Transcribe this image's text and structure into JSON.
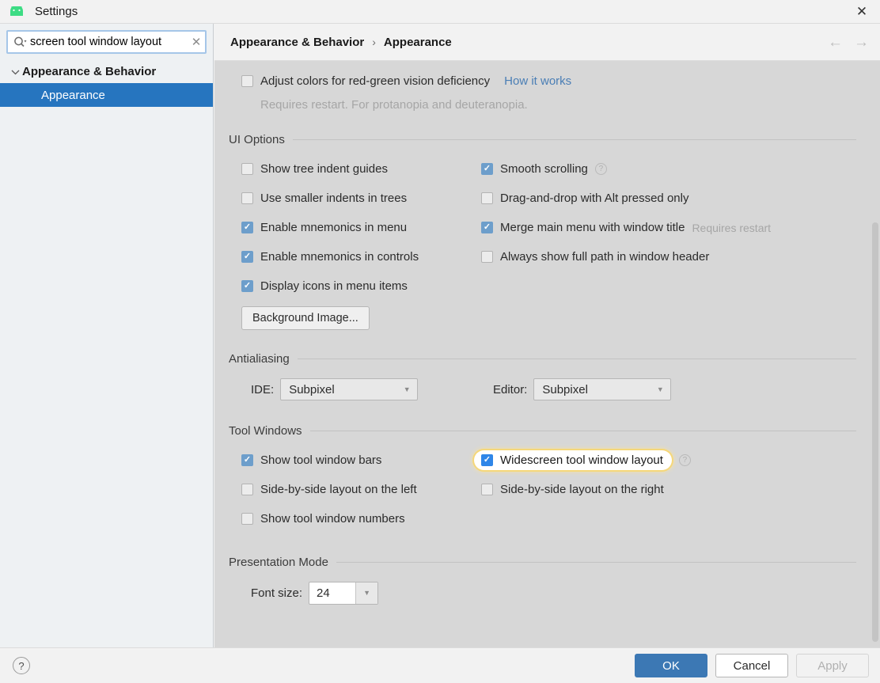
{
  "window": {
    "title": "Settings",
    "logo_icon": "android-studio-logo-icon",
    "close_icon": "close-icon"
  },
  "sidebar": {
    "search": {
      "value": "screen tool window layout",
      "placeholder": "Search settings",
      "search_icon": "search-icon",
      "clear_icon": "clear-icon"
    },
    "tree": [
      {
        "label": "Appearance & Behavior",
        "level": "root",
        "expanded": true,
        "selected": false,
        "chevron_icon": "chevron-down-icon"
      },
      {
        "label": "Appearance",
        "level": "child",
        "expanded": false,
        "selected": true
      }
    ]
  },
  "content": {
    "breadcrumb": {
      "parent": "Appearance & Behavior",
      "separator": "›",
      "current": "Appearance"
    },
    "nav": {
      "back_icon": "arrow-left-icon",
      "back_enabled": false,
      "forward_icon": "arrow-right-icon",
      "forward_enabled": false
    },
    "top_partial": {
      "checkbox_label": "Adjust colors for red-green vision deficiency",
      "checked": false,
      "link": "How it works",
      "note": "Requires restart. For protanopia and deuteranopia."
    },
    "sections": [
      {
        "title": "UI Options",
        "left_options": [
          {
            "label": "Show tree indent guides",
            "checked": false
          },
          {
            "label": "Use smaller indents in trees",
            "checked": false
          },
          {
            "label": "Enable mnemonics in menu",
            "checked": true
          },
          {
            "label": "Enable mnemonics in controls",
            "checked": true
          },
          {
            "label": "Display icons in menu items",
            "checked": true
          }
        ],
        "right_options": [
          {
            "label": "Smooth scrolling",
            "checked": true,
            "help": true,
            "hint": ""
          },
          {
            "label": "Drag-and-drop with Alt pressed only",
            "checked": false,
            "help": false,
            "hint": ""
          },
          {
            "label": "Merge main menu with window title",
            "checked": true,
            "help": false,
            "hint": "Requires restart"
          },
          {
            "label": "Always show full path in window header",
            "checked": false,
            "help": false,
            "hint": ""
          }
        ],
        "button": "Background Image..."
      },
      {
        "title": "Antialiasing",
        "combos": [
          {
            "label": "IDE:",
            "value": "Subpixel",
            "arrow_icon": "chevron-down-icon"
          },
          {
            "label": "Editor:",
            "value": "Subpixel",
            "arrow_icon": "chevron-down-icon"
          }
        ]
      },
      {
        "title": "Tool Windows",
        "left_options": [
          {
            "label": "Show tool window bars",
            "checked": true
          },
          {
            "label": "Side-by-side layout on the left",
            "checked": false
          },
          {
            "label": "Show tool window numbers",
            "checked": false
          }
        ],
        "right_options": [
          {
            "label": "Widescreen tool window layout",
            "checked": true,
            "help": true,
            "highlighted": true
          },
          {
            "label": "Side-by-side layout on the right",
            "checked": false,
            "help": false,
            "highlighted": false
          }
        ]
      },
      {
        "title": "Presentation Mode",
        "font_size_label": "Font size:",
        "font_size_value": "24",
        "font_size_arrow_icon": "chevron-down-icon"
      }
    ]
  },
  "footer": {
    "help_icon": "help-icon",
    "ok": "OK",
    "cancel": "Cancel",
    "apply": "Apply"
  },
  "colors": {
    "selection_blue": "#2675bf",
    "primary_button": "#3c78b4",
    "checkbox_blue": "#6d9ecb",
    "highlight_glow": "#f5d77a",
    "link_blue": "#4a7eb5",
    "content_bg": "#d7d7d7"
  }
}
